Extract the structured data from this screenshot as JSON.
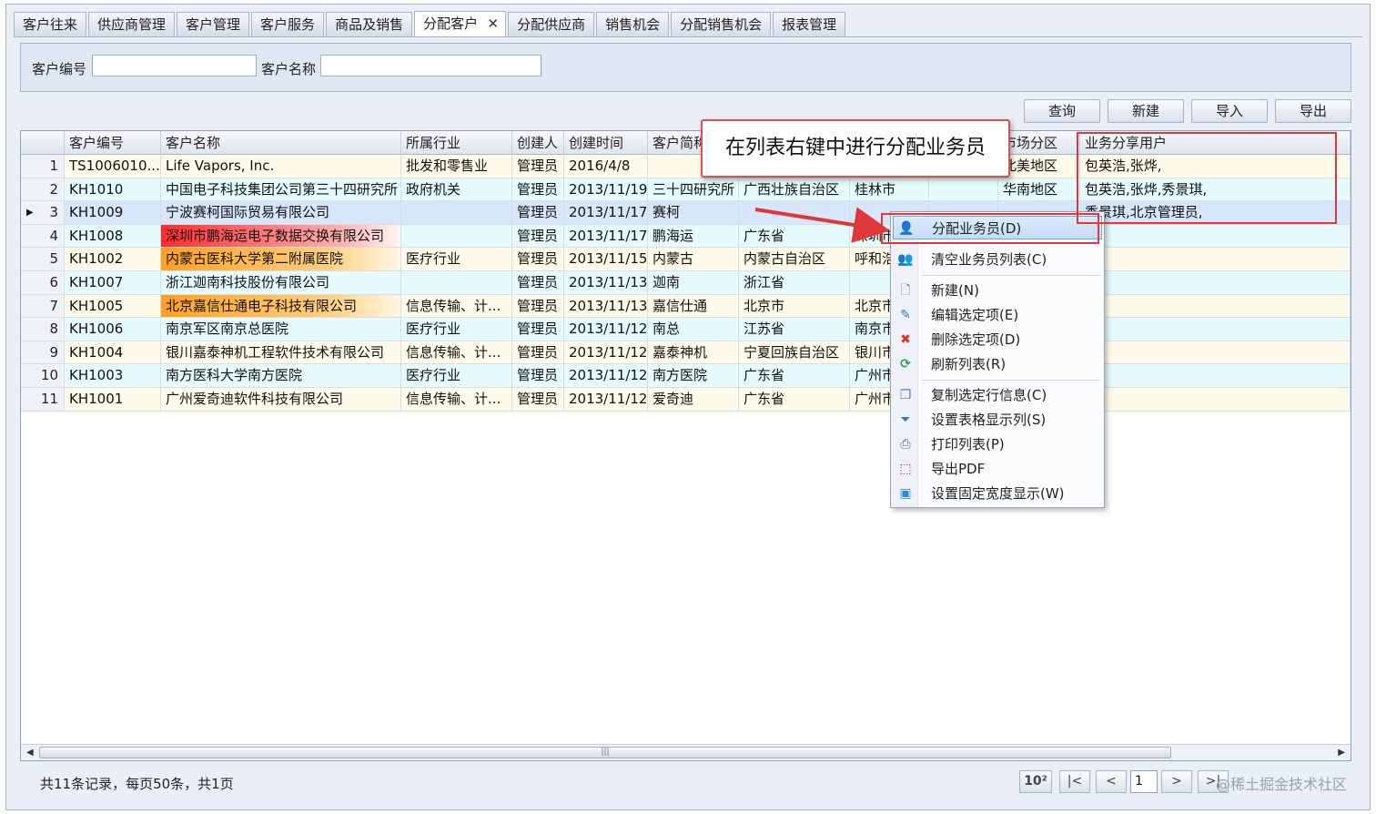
{
  "tabs": [
    {
      "label": "客户往来"
    },
    {
      "label": "供应商管理"
    },
    {
      "label": "客户管理"
    },
    {
      "label": "客户服务"
    },
    {
      "label": "商品及销售"
    },
    {
      "label": "分配客户",
      "active": true
    },
    {
      "label": "分配供应商"
    },
    {
      "label": "销售机会"
    },
    {
      "label": "分配销售机会"
    },
    {
      "label": "报表管理"
    }
  ],
  "search": {
    "code_label": "客户编号",
    "code_value": "",
    "name_label": "客户名称",
    "name_value": ""
  },
  "toolbar": {
    "query": "查询",
    "new": "新建",
    "import": "导入",
    "export": "导出"
  },
  "grid": {
    "columns": [
      "",
      "客户编号",
      "客户名称",
      "所属行业",
      "创建人",
      "创建时间",
      "客户简称",
      "",
      "",
      "",
      "市场分区",
      "业务分享用户"
    ],
    "rows": [
      {
        "n": "1",
        "code": "TS1006010...",
        "name": "Life Vapors, Inc.",
        "industry": "批发和零售业",
        "creator": "管理员",
        "date": "2016/4/8",
        "short": "",
        "prov": "",
        "city": "",
        "c9": "",
        "market": "北美地区",
        "users": "包英浩,张烨,"
      },
      {
        "n": "2",
        "code": "KH1010",
        "name": "中国电子科技集团公司第三十四研究所",
        "industry": "政府机关",
        "creator": "管理员",
        "date": "2013/11/19",
        "short": "三十四研究所",
        "prov": "广西壮族自治区",
        "city": "桂林市",
        "c9": "",
        "market": "华南地区",
        "users": "包英浩,张烨,秀景琪,"
      },
      {
        "n": "3",
        "code": "KH1009",
        "name": "宁波赛柯国际贸易有限公司",
        "industry": "",
        "creator": "管理员",
        "date": "2013/11/17",
        "short": "赛柯",
        "prov": "",
        "city": "",
        "c9": "",
        "market": "",
        "users": "秀景琪,北京管理员,"
      },
      {
        "n": "4",
        "code": "KH1008",
        "name": "深圳市鹏海运电子数据交换有限公司",
        "industry": "",
        "creator": "管理员",
        "date": "2013/11/17",
        "short": "鹏海运",
        "prov": "广东省",
        "city": "深圳市",
        "c9": "",
        "market": "",
        "users": ""
      },
      {
        "n": "5",
        "code": "KH1002",
        "name": "内蒙古医科大学第二附属医院",
        "industry": "医疗行业",
        "creator": "管理员",
        "date": "2013/11/15",
        "short": "内蒙古",
        "prov": "内蒙古自治区",
        "city": "呼和浩",
        "c9": "",
        "market": "",
        "users": ""
      },
      {
        "n": "6",
        "code": "KH1007",
        "name": "浙江迦南科技股份有限公司",
        "industry": "",
        "creator": "管理员",
        "date": "2013/11/13",
        "short": "迦南",
        "prov": "浙江省",
        "city": "",
        "c9": "",
        "market": "",
        "users": ""
      },
      {
        "n": "7",
        "code": "KH1005",
        "name": "北京嘉信仕通电子科技有限公司",
        "industry": "信息传输、计...",
        "creator": "管理员",
        "date": "2013/11/13",
        "short": "嘉信仕通",
        "prov": "北京市",
        "city": "北京市",
        "c9": "",
        "market": "",
        "users": ""
      },
      {
        "n": "8",
        "code": "KH1006",
        "name": "南京军区南京总医院",
        "industry": "医疗行业",
        "creator": "管理员",
        "date": "2013/11/12",
        "short": "南总",
        "prov": "江苏省",
        "city": "南京市",
        "c9": "",
        "market": "",
        "users": ""
      },
      {
        "n": "9",
        "code": "KH1004",
        "name": "银川嘉泰神机工程软件技术有限公司",
        "industry": "信息传输、计...",
        "creator": "管理员",
        "date": "2013/11/12",
        "short": "嘉泰神机",
        "prov": "宁夏回族自治区",
        "city": "银川市",
        "c9": "",
        "market": "",
        "users": ""
      },
      {
        "n": "10",
        "code": "KH1003",
        "name": "南方医科大学南方医院",
        "industry": "医疗行业",
        "creator": "管理员",
        "date": "2013/11/12",
        "short": "南方医院",
        "prov": "广东省",
        "city": "广州市",
        "c9": "",
        "market": "",
        "users": ""
      },
      {
        "n": "11",
        "code": "KH1001",
        "name": "广州爱奇迪软件科技有限公司",
        "industry": "信息传输、计...",
        "creator": "管理员",
        "date": "2013/11/12",
        "short": "爱奇迪",
        "prov": "广东省",
        "city": "广州市",
        "c9": "",
        "market": "",
        "users": ""
      }
    ]
  },
  "context_menu": {
    "items": [
      {
        "label": "分配业务员(D)",
        "icon": "assign-user-icon"
      },
      {
        "label": "清空业务员列表(C)",
        "icon": "users-icon"
      },
      {
        "label": "新建(N)",
        "icon": "new-doc-icon"
      },
      {
        "label": "编辑选定项(E)",
        "icon": "edit-icon"
      },
      {
        "label": "删除选定项(D)",
        "icon": "delete-icon"
      },
      {
        "label": "刷新列表(R)",
        "icon": "refresh-icon"
      },
      {
        "label": "复制选定行信息(C)",
        "icon": "copy-icon"
      },
      {
        "label": "设置表格显示列(S)",
        "icon": "filter-icon"
      },
      {
        "label": "打印列表(P)",
        "icon": "print-icon"
      },
      {
        "label": "导出PDF",
        "icon": "pdf-icon"
      },
      {
        "label": "设置固定宽度显示(W)",
        "icon": "fixed-width-icon"
      }
    ]
  },
  "callout": {
    "text": "在列表右键中进行分配业务员"
  },
  "status": {
    "text": "共11条记录，每页50条，共1页"
  },
  "pager": {
    "page": "1",
    "page_size_icon": "10²",
    "first": "|<",
    "prev": "<",
    "next": ">",
    "last": ">|"
  },
  "watermark": "@稀土掘金技术社区",
  "colors": {
    "highlight_red": "#ff2a2a",
    "highlight_orange": "#ffa020",
    "accent_blue": "#4a7fc1",
    "annotation_red": "#e03838"
  }
}
